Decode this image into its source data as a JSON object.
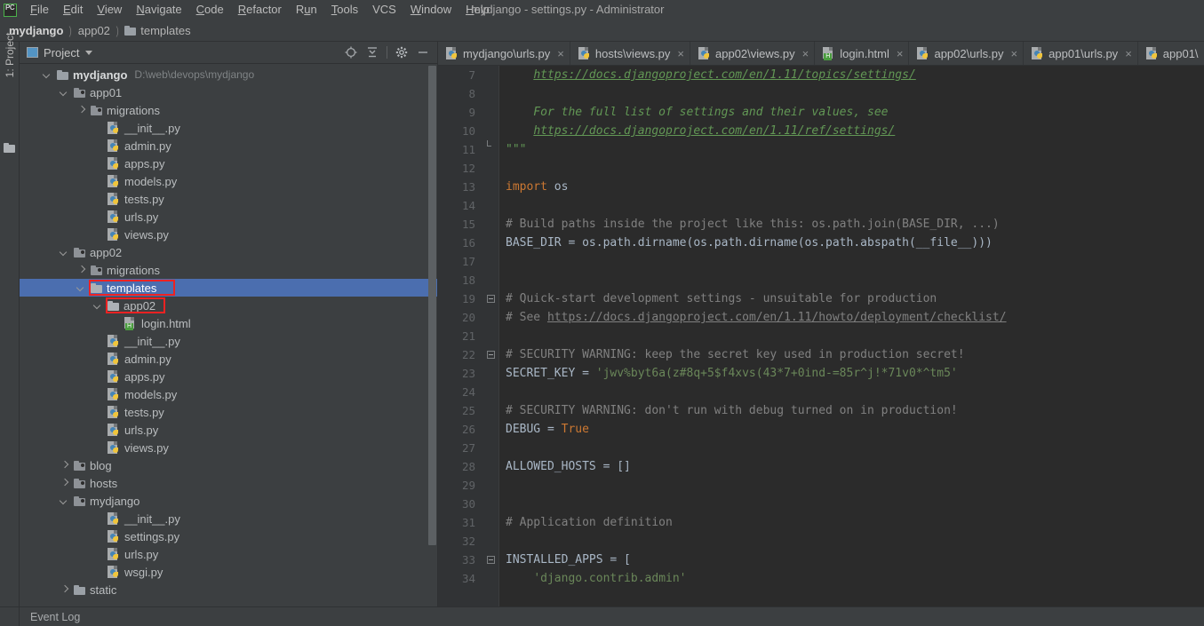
{
  "window": {
    "title": "mydjango - settings.py - Administrator",
    "logo_text": "PC"
  },
  "menubar": {
    "items": [
      {
        "label": "File",
        "mnemonic": "F"
      },
      {
        "label": "Edit",
        "mnemonic": "E"
      },
      {
        "label": "View",
        "mnemonic": "V"
      },
      {
        "label": "Navigate",
        "mnemonic": "N"
      },
      {
        "label": "Code",
        "mnemonic": "C"
      },
      {
        "label": "Refactor",
        "mnemonic": "R"
      },
      {
        "label": "Run",
        "mnemonic": "u"
      },
      {
        "label": "Tools",
        "mnemonic": "T"
      },
      {
        "label": "VCS",
        "mnemonic": ""
      },
      {
        "label": "Window",
        "mnemonic": "W"
      },
      {
        "label": "Help",
        "mnemonic": "H"
      }
    ]
  },
  "breadcrumb": {
    "items": [
      {
        "label": "mydjango",
        "icon": "none"
      },
      {
        "label": "app02",
        "icon": "none"
      },
      {
        "label": "templates",
        "icon": "folder-icon"
      }
    ],
    "separator": ")"
  },
  "left_strip": {
    "tab_label": "1: Project",
    "folder_icon": "folder-icon"
  },
  "project_panel": {
    "title": "Project",
    "title_icon": "project-icon",
    "dropdown_icon": "chevron-down-icon",
    "tools": [
      {
        "name": "locate-in-tree-icon",
        "title": "Select Opened File"
      },
      {
        "name": "collapse-all-icon",
        "title": "Collapse All"
      },
      {
        "name": "gear-icon",
        "title": "Settings"
      },
      {
        "name": "minimize-icon",
        "title": "Hide"
      }
    ],
    "root": {
      "label": "mydjango",
      "path": "D:\\web\\devops\\mydjango"
    },
    "tree": [
      {
        "label": "mydjango",
        "path": "D:\\web\\devops\\mydjango",
        "indent": 0,
        "arrow": "down",
        "icon": "folder",
        "bold": true
      },
      {
        "label": "app01",
        "indent": 1,
        "arrow": "down",
        "icon": "source-folder"
      },
      {
        "label": "migrations",
        "indent": 2,
        "arrow": "right",
        "icon": "source-folder"
      },
      {
        "label": "__init__.py",
        "indent": 3,
        "arrow": "none",
        "icon": "python"
      },
      {
        "label": "admin.py",
        "indent": 3,
        "arrow": "none",
        "icon": "python"
      },
      {
        "label": "apps.py",
        "indent": 3,
        "arrow": "none",
        "icon": "python"
      },
      {
        "label": "models.py",
        "indent": 3,
        "arrow": "none",
        "icon": "python"
      },
      {
        "label": "tests.py",
        "indent": 3,
        "arrow": "none",
        "icon": "python"
      },
      {
        "label": "urls.py",
        "indent": 3,
        "arrow": "none",
        "icon": "python"
      },
      {
        "label": "views.py",
        "indent": 3,
        "arrow": "none",
        "icon": "python"
      },
      {
        "label": "app02",
        "indent": 1,
        "arrow": "down",
        "icon": "source-folder"
      },
      {
        "label": "migrations",
        "indent": 2,
        "arrow": "right",
        "icon": "source-folder"
      },
      {
        "label": "templates",
        "indent": 2,
        "arrow": "down",
        "icon": "template-folder",
        "selected": true,
        "annotated": true
      },
      {
        "label": "app02",
        "indent": 3,
        "arrow": "down",
        "icon": "template-folder",
        "annotated": true
      },
      {
        "label": "login.html",
        "indent": 4,
        "arrow": "none",
        "icon": "html"
      },
      {
        "label": "__init__.py",
        "indent": 3,
        "arrow": "none",
        "icon": "python"
      },
      {
        "label": "admin.py",
        "indent": 3,
        "arrow": "none",
        "icon": "python"
      },
      {
        "label": "apps.py",
        "indent": 3,
        "arrow": "none",
        "icon": "python"
      },
      {
        "label": "models.py",
        "indent": 3,
        "arrow": "none",
        "icon": "python"
      },
      {
        "label": "tests.py",
        "indent": 3,
        "arrow": "none",
        "icon": "python"
      },
      {
        "label": "urls.py",
        "indent": 3,
        "arrow": "none",
        "icon": "python"
      },
      {
        "label": "views.py",
        "indent": 3,
        "arrow": "none",
        "icon": "python"
      },
      {
        "label": "blog",
        "indent": 1,
        "arrow": "right",
        "icon": "source-folder"
      },
      {
        "label": "hosts",
        "indent": 1,
        "arrow": "right",
        "icon": "source-folder"
      },
      {
        "label": "mydjango",
        "indent": 1,
        "arrow": "down",
        "icon": "source-folder"
      },
      {
        "label": "__init__.py",
        "indent": 3,
        "arrow": "none",
        "icon": "python"
      },
      {
        "label": "settings.py",
        "indent": 3,
        "arrow": "none",
        "icon": "python"
      },
      {
        "label": "urls.py",
        "indent": 3,
        "arrow": "none",
        "icon": "python"
      },
      {
        "label": "wsgi.py",
        "indent": 3,
        "arrow": "none",
        "icon": "python"
      },
      {
        "label": "static",
        "indent": 1,
        "arrow": "right",
        "icon": "folder"
      }
    ]
  },
  "editor": {
    "tabs": [
      {
        "label": "mydjango\\urls.py",
        "icon": "python",
        "close": "×",
        "active": false
      },
      {
        "label": "hosts\\views.py",
        "icon": "python",
        "close": "×",
        "active": false
      },
      {
        "label": "app02\\views.py",
        "icon": "python",
        "close": "×",
        "active": false
      },
      {
        "label": "login.html",
        "icon": "html",
        "close": "×",
        "active": false
      },
      {
        "label": "app02\\urls.py",
        "icon": "python",
        "close": "×",
        "active": false
      },
      {
        "label": "app01\\urls.py",
        "icon": "python",
        "close": "×",
        "active": false
      },
      {
        "label": "app01\\",
        "icon": "python",
        "close": "",
        "active": false
      }
    ],
    "first_line_number": 7,
    "lines": [
      {
        "n": 7,
        "fold": "none",
        "tokens": [
          {
            "t": "    ",
            "c": "s-txt"
          },
          {
            "t": "https://docs.djangoproject.com/en/1.11/topics/settings/",
            "c": "s-link"
          }
        ]
      },
      {
        "n": 8,
        "fold": "none",
        "tokens": []
      },
      {
        "n": 9,
        "fold": "none",
        "tokens": [
          {
            "t": "    For the full list of settings and their values, see",
            "c": "s-docs"
          }
        ]
      },
      {
        "n": 10,
        "fold": "none",
        "tokens": [
          {
            "t": "    ",
            "c": "s-txt"
          },
          {
            "t": "https://docs.djangoproject.com/en/1.11/ref/settings/",
            "c": "s-link"
          }
        ]
      },
      {
        "n": 11,
        "fold": "tail",
        "tokens": [
          {
            "t": "\"\"\"",
            "c": "s-docs"
          }
        ]
      },
      {
        "n": 12,
        "fold": "none",
        "tokens": []
      },
      {
        "n": 13,
        "fold": "none",
        "tokens": [
          {
            "t": "import",
            "c": "s-kw"
          },
          {
            "t": " os",
            "c": "s-txt"
          }
        ]
      },
      {
        "n": 14,
        "fold": "none",
        "tokens": []
      },
      {
        "n": 15,
        "fold": "none",
        "tokens": [
          {
            "t": "# Build paths inside the project like this: os.path.join(BASE_DIR, ...)",
            "c": "s-comment"
          }
        ]
      },
      {
        "n": 16,
        "fold": "none",
        "tokens": [
          {
            "t": "BASE_DIR = os.path.dirname(os.path.dirname(os.path.abspath(__file__)))",
            "c": "s-txt"
          }
        ]
      },
      {
        "n": 17,
        "fold": "none",
        "tokens": []
      },
      {
        "n": 18,
        "fold": "none",
        "tokens": []
      },
      {
        "n": 19,
        "fold": "minus",
        "tokens": [
          {
            "t": "# Quick-start development settings - unsuitable for production",
            "c": "s-comment"
          }
        ]
      },
      {
        "n": 20,
        "fold": "none",
        "tokens": [
          {
            "t": "# See ",
            "c": "s-comment"
          },
          {
            "t": "https://docs.djangoproject.com/en/1.11/howto/deployment/checklist/",
            "c": "s-link2"
          }
        ]
      },
      {
        "n": 21,
        "fold": "none",
        "tokens": []
      },
      {
        "n": 22,
        "fold": "minus",
        "tokens": [
          {
            "t": "# SECURITY WARNING: keep the secret key used in production secret!",
            "c": "s-comment"
          }
        ]
      },
      {
        "n": 23,
        "fold": "none",
        "tokens": [
          {
            "t": "SECRET_KEY = ",
            "c": "s-txt"
          },
          {
            "t": "'jwv%byt6a(z#8q+5$f4xvs(43*7+0ind-=85r^j!*71v0*^tm5'",
            "c": "s-str"
          }
        ]
      },
      {
        "n": 24,
        "fold": "none",
        "tokens": []
      },
      {
        "n": 25,
        "fold": "none",
        "tokens": [
          {
            "t": "# SECURITY WARNING: don't run with debug turned on in production!",
            "c": "s-comment"
          }
        ]
      },
      {
        "n": 26,
        "fold": "none",
        "tokens": [
          {
            "t": "DEBUG = ",
            "c": "s-txt"
          },
          {
            "t": "True",
            "c": "s-const"
          }
        ]
      },
      {
        "n": 27,
        "fold": "none",
        "tokens": []
      },
      {
        "n": 28,
        "fold": "none",
        "tokens": [
          {
            "t": "ALLOWED_HOSTS = []",
            "c": "s-txt"
          }
        ]
      },
      {
        "n": 29,
        "fold": "none",
        "tokens": []
      },
      {
        "n": 30,
        "fold": "none",
        "tokens": []
      },
      {
        "n": 31,
        "fold": "none",
        "tokens": [
          {
            "t": "# Application definition",
            "c": "s-comment"
          }
        ]
      },
      {
        "n": 32,
        "fold": "none",
        "tokens": []
      },
      {
        "n": 33,
        "fold": "minus",
        "tokens": [
          {
            "t": "INSTALLED_APPS = [",
            "c": "s-txt"
          }
        ]
      },
      {
        "n": 34,
        "fold": "none",
        "tokens": [
          {
            "t": "    ",
            "c": "s-txt"
          },
          {
            "t": "'django.contrib.admin'",
            "c": "s-str"
          }
        ]
      }
    ]
  },
  "statusbar": {
    "event_log": "Event Log"
  },
  "colors": {
    "chrome_bg": "#3c3f41",
    "editor_bg": "#2b2b2b",
    "gutter_bg": "#313335",
    "selection_blue": "#4b6eaf",
    "annotation_red": "#ee2222",
    "text_primary": "#babdbf",
    "comment_gray": "#808080",
    "string_green": "#6a8759",
    "keyword_orange": "#cc7832",
    "doc_green": "#629755"
  }
}
